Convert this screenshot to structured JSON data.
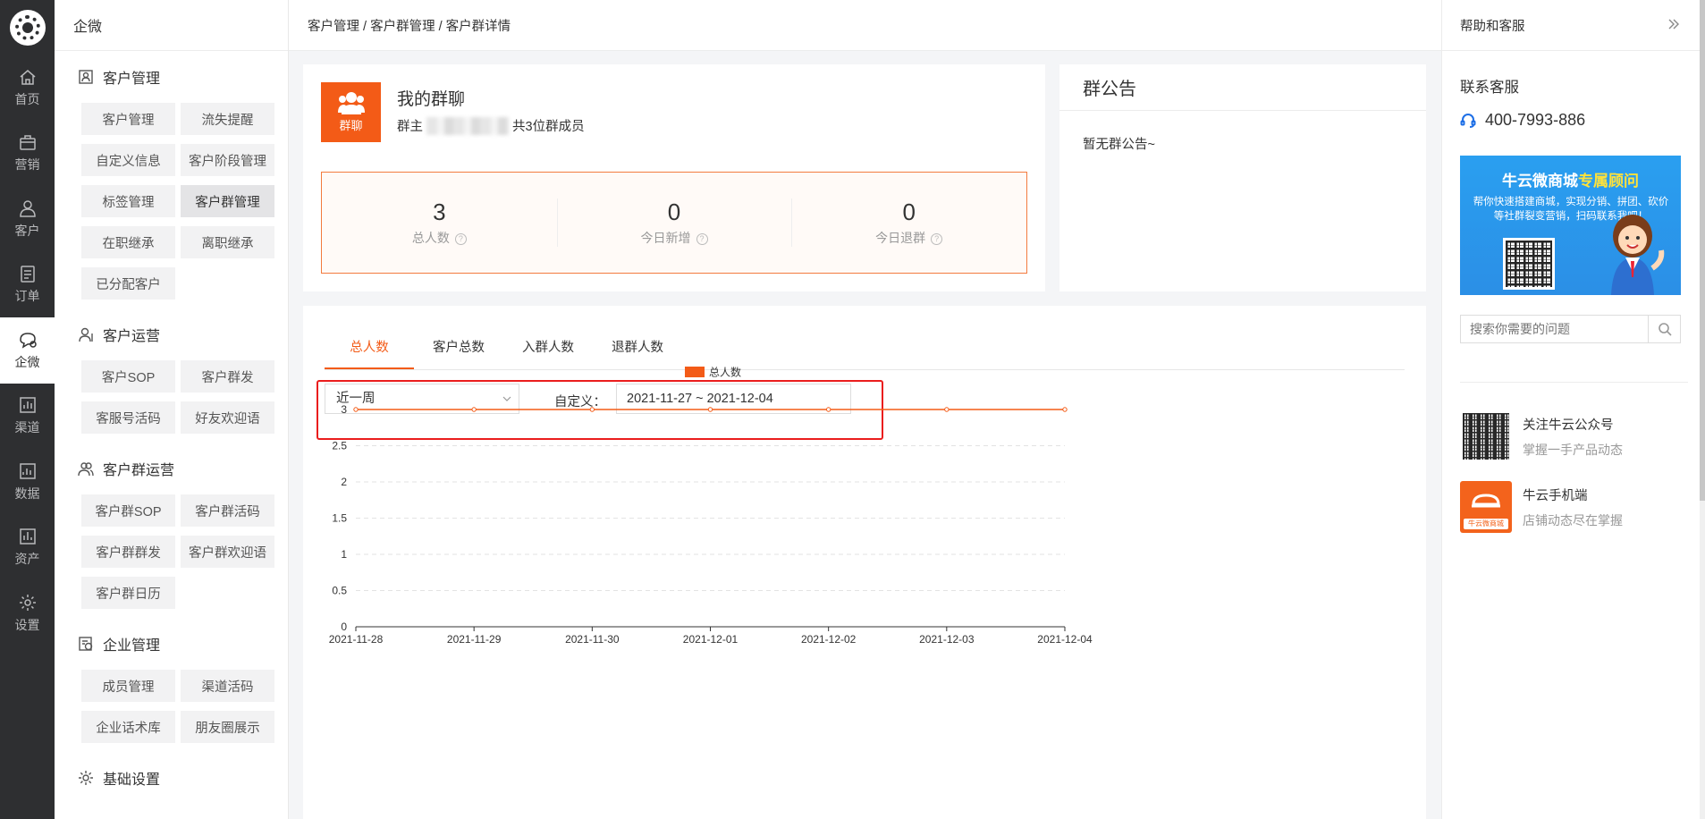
{
  "rail": {
    "items": [
      {
        "label": "首页",
        "icon": "home-icon"
      },
      {
        "label": "营销",
        "icon": "bag-icon"
      },
      {
        "label": "客户",
        "icon": "user-icon"
      },
      {
        "label": "订单",
        "icon": "order-icon"
      },
      {
        "label": "企微",
        "icon": "chat-icon",
        "active": true
      },
      {
        "label": "渠道",
        "icon": "bar-chart-icon"
      },
      {
        "label": "数据",
        "icon": "data-icon"
      },
      {
        "label": "资产",
        "icon": "asset-icon"
      },
      {
        "label": "设置",
        "icon": "gear-icon"
      }
    ]
  },
  "sidebar": {
    "title": "企微",
    "groups": [
      {
        "title": "客户管理",
        "icon": "contact-icon",
        "items": [
          "客户管理",
          "流失提醒",
          "自定义信息",
          "客户阶段管理",
          "标签管理",
          "客户群管理",
          "在职继承",
          "离职继承",
          "已分配客户"
        ],
        "active": "客户群管理"
      },
      {
        "title": "客户运营",
        "icon": "operate-icon",
        "items": [
          "客户SOP",
          "客户群发",
          "客服号活码",
          "好友欢迎语"
        ]
      },
      {
        "title": "客户群运营",
        "icon": "group-icon",
        "items": [
          "客户群SOP",
          "客户群活码",
          "客户群群发",
          "客户群欢迎语",
          "客户群日历"
        ]
      },
      {
        "title": "企业管理",
        "icon": "enterprise-icon",
        "items": [
          "成员管理",
          "渠道活码",
          "企业话术库",
          "朋友圈展示"
        ]
      },
      {
        "title": "基础设置",
        "icon": "settings-icon",
        "items": []
      }
    ]
  },
  "breadcrumb": "客户管理 / 客户群管理 / 客户群详情",
  "group": {
    "avatar_label": "群聊",
    "name": "我的群聊",
    "owner_prefix": "群主",
    "owner_suffix": "共3位群成员",
    "stats": [
      {
        "value": "3",
        "label": "总人数"
      },
      {
        "value": "0",
        "label": "今日新增"
      },
      {
        "value": "0",
        "label": "今日退群"
      }
    ]
  },
  "notice": {
    "title": "群公告",
    "text": "暂无群公告~"
  },
  "chart_panel": {
    "tabs": [
      "总人数",
      "客户总数",
      "入群人数",
      "退群人数"
    ],
    "active_tab": "总人数",
    "range_select": "近一周",
    "custom_label": "自定义：",
    "date_range": "2021-11-27 ~ 2021-12-04"
  },
  "chart_data": {
    "type": "line",
    "series": [
      {
        "name": "总人数",
        "color": "#f35b17",
        "values": [
          3,
          3,
          3,
          3,
          3,
          3,
          3
        ]
      }
    ],
    "x": [
      "2021-11-28",
      "2021-11-29",
      "2021-11-30",
      "2021-12-01",
      "2021-12-02",
      "2021-12-03",
      "2021-12-04"
    ],
    "yticks": [
      "0",
      "0.5",
      "1",
      "1.5",
      "2",
      "2.5",
      "3"
    ],
    "ylim": [
      0,
      3
    ],
    "legend": "top-center",
    "grid": true
  },
  "help": {
    "title": "帮助和客服",
    "service_label": "联系客服",
    "phone": "400-7993-886",
    "banner_title_white": "牛云微商城",
    "banner_title_yellow": "专属顾问",
    "banner_text": "帮你快速搭建商城，实现分销、拼团、砍价等社群裂变营销，扫码联系我吧！",
    "search_placeholder": "搜索你需要的问题",
    "promos": [
      {
        "title": "关注牛云公众号",
        "subtitle": "掌握一手产品动态",
        "icon": "qr-code-icon"
      },
      {
        "title": "牛云手机端",
        "subtitle": "店铺动态尽在掌握",
        "icon": "niuyun-app-icon",
        "tag": "牛云微商城"
      }
    ]
  },
  "colors": {
    "accent": "#f35b17",
    "highlight_border": "#ea1d1d",
    "rail_bg": "#2e2f31"
  }
}
